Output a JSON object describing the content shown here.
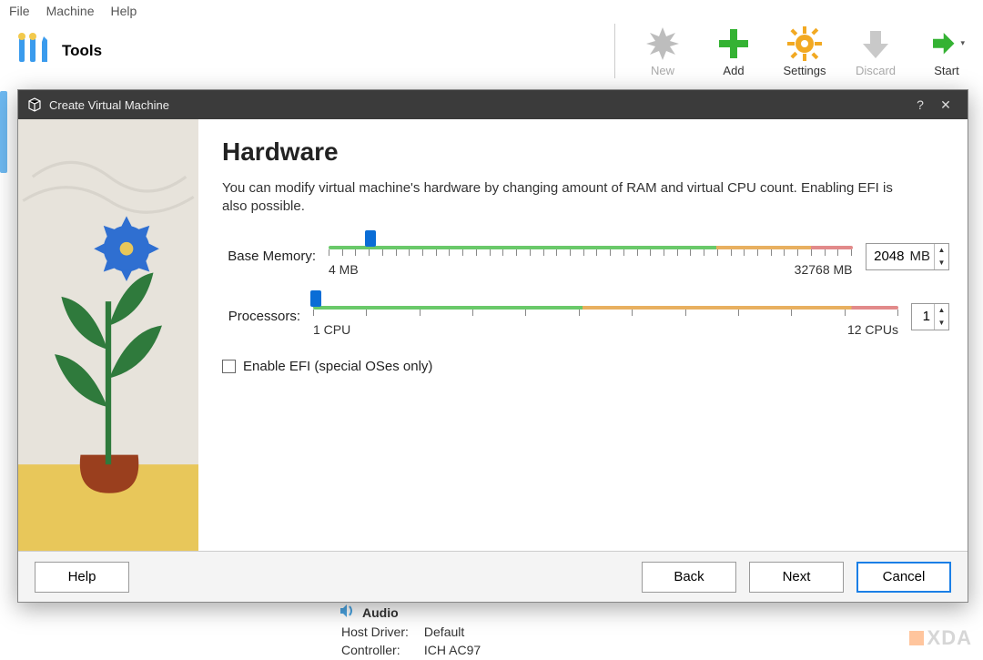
{
  "menubar": {
    "file": "File",
    "machine": "Machine",
    "help": "Help"
  },
  "toolbar": {
    "tools": "Tools",
    "new": "New",
    "add": "Add",
    "settings": "Settings",
    "discard": "Discard",
    "start": "Start"
  },
  "dialog": {
    "title": "Create Virtual Machine",
    "heading": "Hardware",
    "description": "You can modify virtual machine's hardware by changing amount of RAM and virtual CPU count. Enabling EFI is also possible.",
    "memory": {
      "label": "Base Memory:",
      "min_label": "4 MB",
      "max_label": "32768 MB",
      "value": "2048",
      "unit": "MB",
      "thumb_pct": 8,
      "green_pct": 74,
      "orange_pct": 92
    },
    "cpu": {
      "label": "Processors:",
      "min_label": "1 CPU",
      "max_label": "12 CPUs",
      "value": "1",
      "thumb_pct": 0.5,
      "green_pct": 46,
      "orange_pct": 92
    },
    "efi": {
      "label": "Enable EFI (special OSes only)",
      "checked": false
    },
    "buttons": {
      "help": "Help",
      "back": "Back",
      "next": "Next",
      "cancel": "Cancel"
    }
  },
  "background_panel": {
    "section": "Audio",
    "rows": [
      {
        "k": "Host Driver:",
        "v": "Default"
      },
      {
        "k": "Controller:",
        "v": "ICH AC97"
      }
    ]
  },
  "watermark": "XDA"
}
